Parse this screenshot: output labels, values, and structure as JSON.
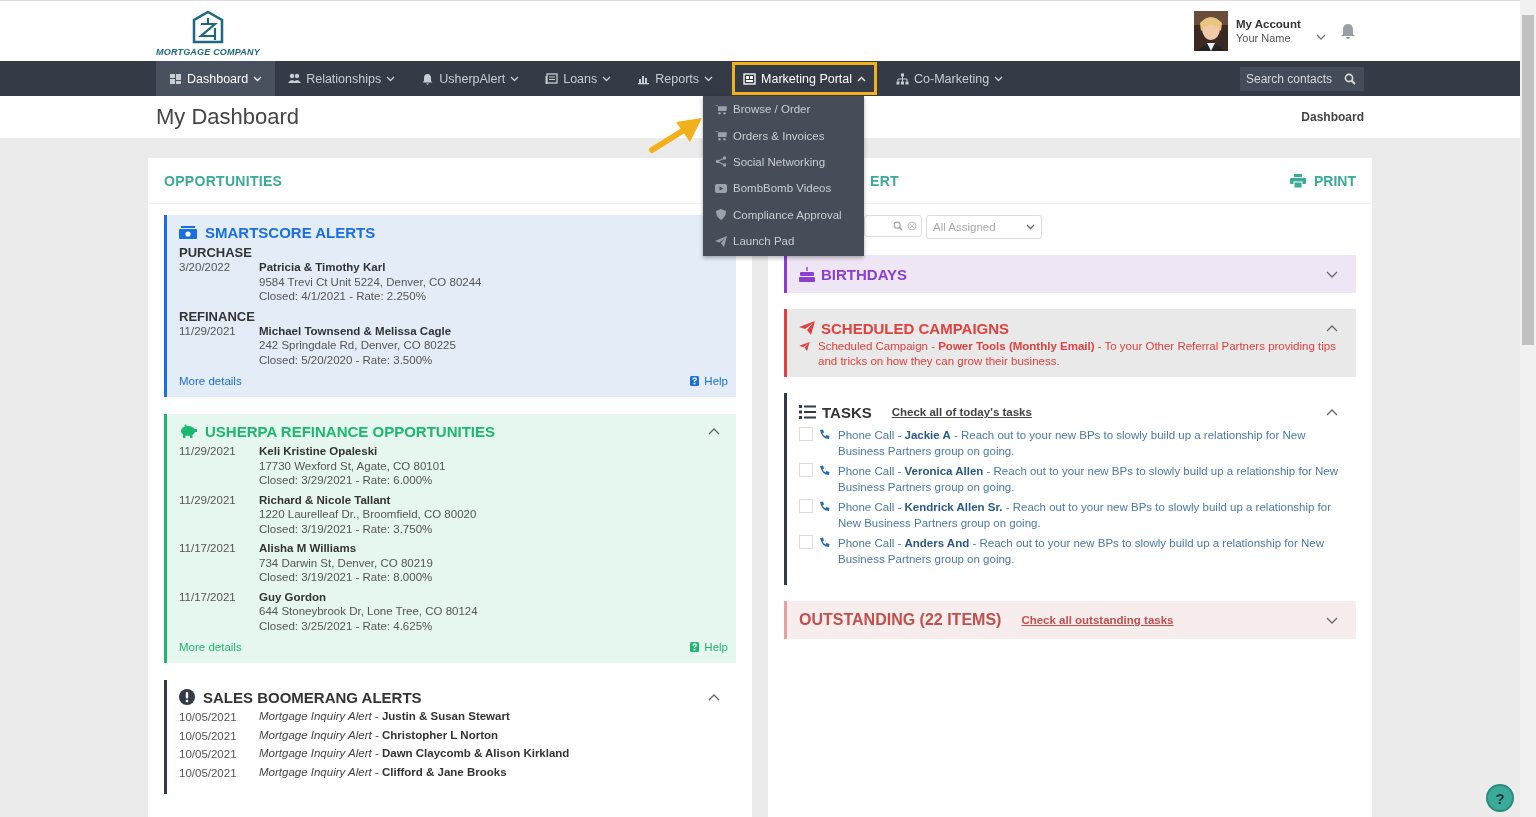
{
  "logo": {
    "name": "MORTGAGE COMPANY"
  },
  "account": {
    "title": "My Account",
    "name": "Your Name"
  },
  "nav": [
    {
      "label": "Dashboard",
      "kind": "grid",
      "selected": true,
      "expanded": false,
      "highlighted": false
    },
    {
      "label": "Relationships",
      "kind": "people",
      "selected": false,
      "expanded": false,
      "highlighted": false
    },
    {
      "label": "UsherpAlert",
      "kind": "bell",
      "selected": false,
      "expanded": false,
      "highlighted": false
    },
    {
      "label": "Loans",
      "kind": "notes",
      "selected": false,
      "expanded": false,
      "highlighted": false
    },
    {
      "label": "Reports",
      "kind": "chart",
      "selected": false,
      "expanded": false,
      "highlighted": false
    },
    {
      "label": "Marketing Portal",
      "kind": "store",
      "selected": false,
      "expanded": true,
      "highlighted": true
    },
    {
      "label": "Co-Marketing",
      "kind": "network",
      "selected": false,
      "expanded": false,
      "highlighted": false
    }
  ],
  "search": {
    "placeholder": "Search contacts"
  },
  "dropdown": [
    {
      "label": "Browse / Order",
      "kind": "cart"
    },
    {
      "label": "Orders & Invoices",
      "kind": "cart"
    },
    {
      "label": "Social Networking",
      "kind": "share"
    },
    {
      "label": "BombBomb Videos",
      "kind": "video"
    },
    {
      "label": "Compliance Approval",
      "kind": "shield"
    },
    {
      "label": "Launch Pad",
      "kind": "plane"
    }
  ],
  "page_title": "My Dashboard",
  "breadcrumb": "Dashboard",
  "opportunities": {
    "title": "OPPORTUNITIES",
    "smartscore": {
      "title": "SMARTSCORE ALERTS",
      "groups": [
        {
          "heading": "PURCHASE",
          "items": [
            {
              "date": "3/20/2022",
              "name": "Patricia & Timothy Karl",
              "address": "9584 Trevi Ct Unit 5224, Denver, CO 80244",
              "closed": "Closed: 4/1/2021 - Rate: 2.250%"
            }
          ]
        },
        {
          "heading": "REFINANCE",
          "items": [
            {
              "date": "11/29/2021",
              "name": "Michael Townsend & Melissa Cagle",
              "address": "242 Springdale Rd, Denver, CO 80225",
              "closed": "Closed: 5/20/2020 - Rate: 3.500%"
            }
          ]
        }
      ],
      "more": "More details",
      "help": "Help"
    },
    "refinance": {
      "title": "USHERPA REFINANCE OPPORTUNITIES",
      "expanded": true,
      "items": [
        {
          "date": "11/29/2021",
          "name": "Keli Kristine Opaleski",
          "address": "17730 Wexford St, Agate, CO 80101",
          "closed": "Closed: 3/29/2021 - Rate: 6.000%"
        },
        {
          "date": "11/29/2021",
          "name": "Richard & Nicole Tallant",
          "address": "1220 Laurelleaf Dr., Broomfield, CO 80020",
          "closed": "Closed: 3/19/2021 - Rate: 3.750%"
        },
        {
          "date": "11/17/2021",
          "name": "Alisha M Williams",
          "address": "734 Darwin St, Denver, CO 80219",
          "closed": "Closed: 3/19/2021 - Rate: 8.000%"
        },
        {
          "date": "11/17/2021",
          "name": "Guy Gordon",
          "address": "644 Stoneybrook Dr, Lone Tree, CO 80124",
          "closed": "Closed: 3/25/2021 - Rate: 4.625%"
        }
      ],
      "more": "More details",
      "help": "Help"
    },
    "boomerang": {
      "title": "SALES BOOMERANG ALERTS",
      "expanded": true,
      "items": [
        {
          "date": "10/05/2021",
          "text": "*Mortgage Inquiry Alert* - **Justin & Susan Stewart**"
        },
        {
          "date": "10/05/2021",
          "text": "*Mortgage Inquiry Alert* - **Christopher L Norton**"
        },
        {
          "date": "10/05/2021",
          "text": "*Mortgage Inquiry Alert* - **Dawn Claycomb & Alison Kirkland**"
        },
        {
          "date": "10/05/2021",
          "text": "*Mortgage Inquiry Alert* - **Clifford & Jane Brooks**"
        }
      ]
    }
  },
  "right": {
    "title": "ERT",
    "print": "PRINT",
    "assigned": "All Assigned",
    "birthdays": {
      "title": "BIRTHDAYS",
      "expanded": false
    },
    "campaigns": {
      "title": "SCHEDULED CAMPAIGNS",
      "expanded": true,
      "items": [
        "Scheduled Campaign - **Power Tools (Monthly Email)** - To your Other Referral Partners providing tips and tricks on how they can grow their business."
      ]
    },
    "tasks": {
      "title": "TASKS",
      "link": "Check all of today's tasks",
      "expanded": true,
      "items": [
        {
          "text": "Phone Call - **Jackie A** - Reach out to your new BPs to slowly build up a relationship for New Business Partners group on going.",
          "checked": false
        },
        {
          "text": "Phone Call - **Veronica Allen** - Reach out to your new BPs to slowly build up a relationship for New Business Partners group on going.",
          "checked": false
        },
        {
          "text": "Phone Call - **Kendrick Allen Sr.** - Reach out to your new BPs to slowly build up a relationship for New Business Partners group on going.",
          "checked": false
        },
        {
          "text": "Phone Call - **Anders And** - Reach out to your new BPs to slowly build up a relationship for New Business Partners group on going.",
          "checked": false
        }
      ]
    },
    "outstanding": {
      "title": "OUTSTANDING (22 ITEMS)",
      "link": "Check all outstanding tasks",
      "expanded": false
    }
  },
  "help_button": "?"
}
